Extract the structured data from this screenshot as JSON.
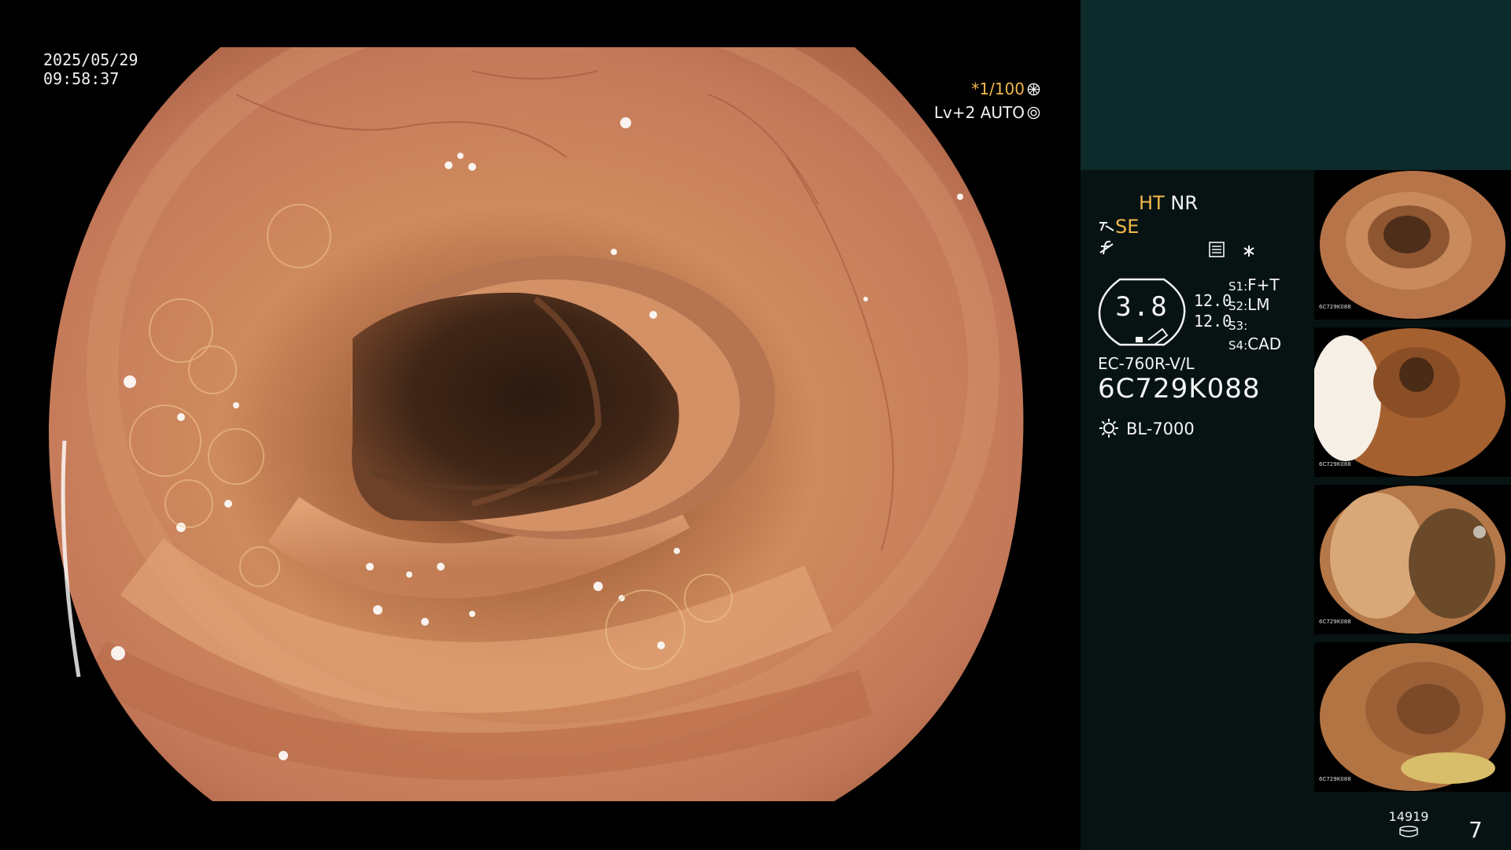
{
  "main_view": {
    "date": "2025/05/29",
    "time": "09:58:37",
    "shutter_speed": "1/100",
    "shutter_prefix": "*",
    "enhance_level": "Lv+2",
    "iris_mode": "AUTO"
  },
  "status": {
    "ht": "HT",
    "nr": "NR",
    "se": "SE",
    "gauge_value": "3.8",
    "gauge_val_a": "12.0",
    "gauge_val_b": "12.0",
    "s1_key": "S1:",
    "s1_val": "F+T",
    "s2_key": "S2:",
    "s2_val": "LM",
    "s3_key": "S3:",
    "s3_val": "",
    "s4_key": "S4:",
    "s4_val": "CAD",
    "scope_model": "EC-760R-V/L",
    "scope_serial": "6C729K088",
    "light_source": "BL-7000"
  },
  "thumbnails": [
    {
      "label": "6C729K088"
    },
    {
      "label": "6C729K088"
    },
    {
      "label": "6C729K088"
    },
    {
      "label": "6C729K088"
    }
  ],
  "footer": {
    "storage_count": "14919",
    "image_count": "7"
  },
  "colors": {
    "accent_orange": "#f2b84b",
    "panel_bg": "#071313",
    "panel_top_bg": "#0d2b2b"
  }
}
